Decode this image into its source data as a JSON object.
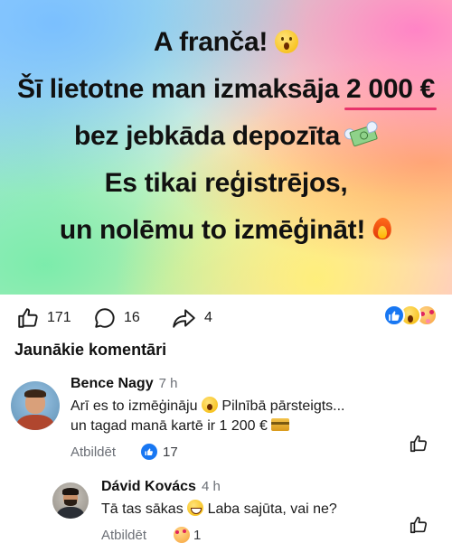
{
  "banner": {
    "line1": "A franča!",
    "line2_prefix": "Šī lietotne man izmaksāja",
    "line2_amount": "2 000 €",
    "line3": "bez jebkāda depozīta",
    "line4": "Es tikai reģistrējos,",
    "line5": "un nolēmu to izmēģināt!",
    "accent_color": "#e8336b",
    "icons": [
      "astonished-face-icon",
      "money-with-wings-icon",
      "fire-icon"
    ]
  },
  "actions": {
    "likes": "171",
    "comments": "16",
    "shares": "4",
    "reactions": [
      "like-reaction-icon",
      "wow-reaction-icon",
      "love-reaction-icon"
    ]
  },
  "section_title": "Jaunākie komentāri",
  "comments": [
    {
      "name": "Bence Nagy",
      "time": "7 h",
      "text_a": "Arī es to izmēģināju",
      "text_b": "Pilnībā pārsteigts...",
      "text_c": "un tagad manā kartē ir 1 200 €",
      "reply_label": "Atbildēt",
      "reaction_count": "17"
    },
    {
      "name": "Dávid Kovács",
      "time": "4 h",
      "text_a": "Tā tas sākas",
      "text_b": "Laba sajūta, vai ne?",
      "reply_label": "Atbildēt",
      "reaction_count": "1"
    }
  ],
  "colors": {
    "like_blue": "#1877f2",
    "text_dark": "#111111",
    "meta_gray": "#6b6f76"
  }
}
